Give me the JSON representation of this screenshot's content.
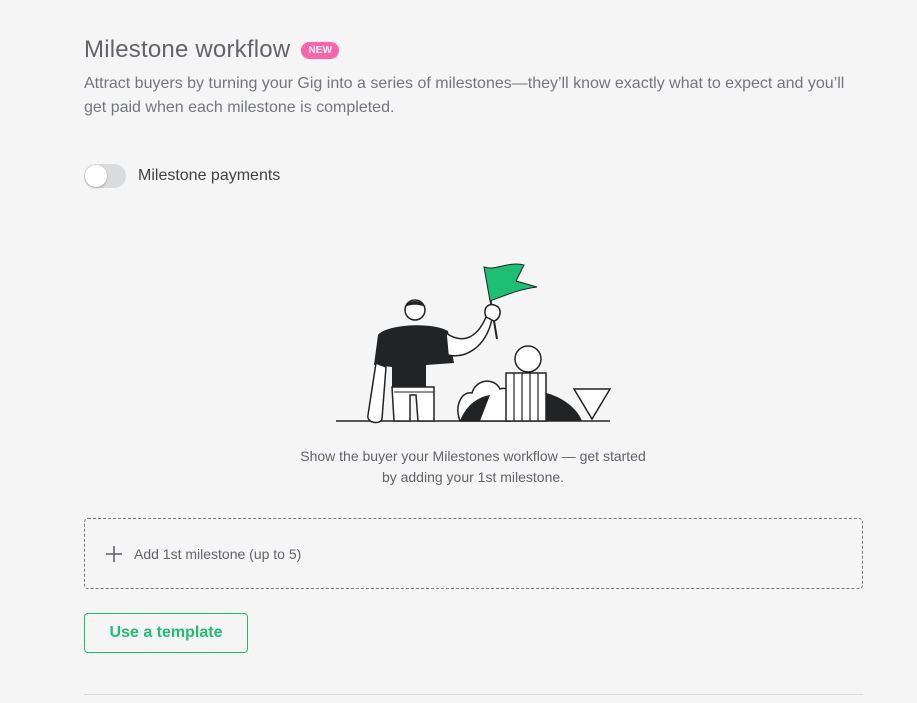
{
  "header": {
    "title": "Milestone workflow",
    "badge": "NEW",
    "description": "Attract buyers by turning your Gig into a series of milestones—they’ll know exactly what to expect and you’ll get paid when each milestone is completed."
  },
  "toggle": {
    "label": "Milestone payments",
    "enabled": false
  },
  "empty_state": {
    "illustration": "person-raising-flag-illustration",
    "message": "Show the buyer your Milestones workflow — get started by adding your 1st milestone."
  },
  "add_milestone": {
    "label": "Add 1st milestone (up to 5)",
    "icon": "plus-icon"
  },
  "template_button": {
    "label": "Use a template"
  },
  "colors": {
    "accent_green": "#1dbf73",
    "badge_pink": "#ff62ad",
    "flag_green": "#1dbf73"
  }
}
